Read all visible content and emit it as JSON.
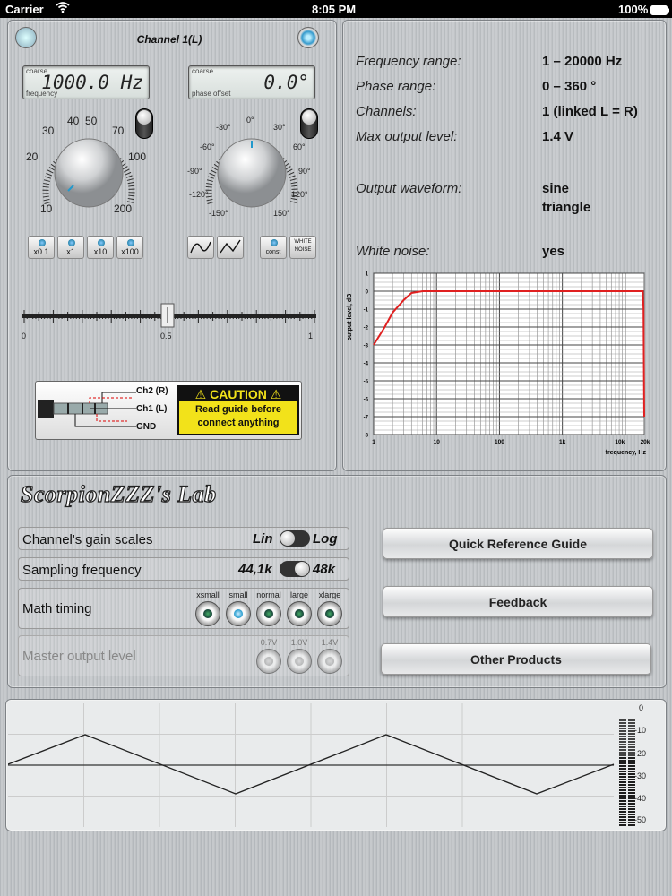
{
  "status": {
    "carrier": "Carrier",
    "time": "8:05 PM",
    "battery": "100%"
  },
  "channel": {
    "title": "Channel 1(L)",
    "freq_display": {
      "top": "coarse",
      "bottom": "frequency",
      "value": "1000.0 Hz"
    },
    "phase_display": {
      "top": "coarse",
      "value": "0.0°",
      "bottom": "phase offset"
    },
    "freq_scale": [
      "10",
      "20",
      "30",
      "40",
      "50",
      "70",
      "100",
      "200"
    ],
    "phase_scale": [
      "-30°",
      "0°",
      "30°",
      "-60°",
      "60°",
      "-90°",
      "90°",
      "-120°",
      "120°",
      "-150°",
      "150°"
    ],
    "multipliers": [
      "x0.1",
      "x1",
      "x10",
      "x100"
    ],
    "wave_buttons": [
      "sine",
      "triangle",
      "const",
      "WHITE NOISE"
    ],
    "const_label": "const",
    "noise_label": "WHITE NOISE",
    "slider": {
      "min": "0",
      "mid": "0.5",
      "max": "1",
      "value": 0.5
    },
    "caution": {
      "title": "CAUTION",
      "line1": "Read guide before",
      "line2": "connect anything",
      "ch2": "Ch2 (R)",
      "ch1": "Ch1 (L)",
      "gnd": "GND"
    }
  },
  "specs": [
    {
      "k": "Frequency range:",
      "v": "1 – 20000 Hz"
    },
    {
      "k": "Phase range:",
      "v": "0 – 360 °"
    },
    {
      "k": "Channels:",
      "v": "1 (linked L = R)"
    },
    {
      "k": "Max output level:",
      "v": "1.4 V"
    },
    {
      "k": "Output waveform:",
      "v": "sine",
      "v2": "triangle"
    },
    {
      "k": "White noise:",
      "v": "yes"
    }
  ],
  "chart_data": {
    "type": "line",
    "ylabel": "output level, dB",
    "xlabel": "frequency, Hz",
    "x_ticks": [
      "1",
      "10",
      "100",
      "1k",
      "10k",
      "20k"
    ],
    "y_ticks": [
      "1",
      "0",
      "-1",
      "-2",
      "-3",
      "-4",
      "-5",
      "-6",
      "-7",
      "-8"
    ],
    "ylim": [
      -8,
      1
    ],
    "xlim": [
      1,
      20000
    ],
    "x_scale": "log",
    "grid": true,
    "series": [
      {
        "color": "#e02020",
        "x": [
          1,
          1.5,
          2,
          3,
          4,
          6,
          10,
          100,
          1000,
          10000,
          19000,
          19500,
          20000
        ],
        "y": [
          -3,
          -2,
          -1.2,
          -0.5,
          -0.1,
          0,
          0,
          0,
          0,
          0,
          0,
          -1,
          -7
        ]
      }
    ]
  },
  "lab": {
    "title": "ScorpionZZZ's Lab",
    "gain_label": "Channel's gain scales",
    "gain_opt1": "Lin",
    "gain_opt2": "Log",
    "sampling_label": "Sampling frequency",
    "sampling_opt1": "44,1k",
    "sampling_opt2": "48k",
    "math_label": "Math timing",
    "math_opts": [
      "xsmall",
      "small",
      "normal",
      "large",
      "xlarge"
    ],
    "master_label": "Master output level",
    "master_opts": [
      "0.7V",
      "1.0V",
      "1.4V"
    ],
    "buttons": [
      "Quick Reference Guide",
      "Feedback",
      "Other Products"
    ]
  },
  "scope": {
    "vu_scale": [
      "0",
      "-10",
      "-20",
      "-30",
      "-40",
      "-50"
    ]
  }
}
